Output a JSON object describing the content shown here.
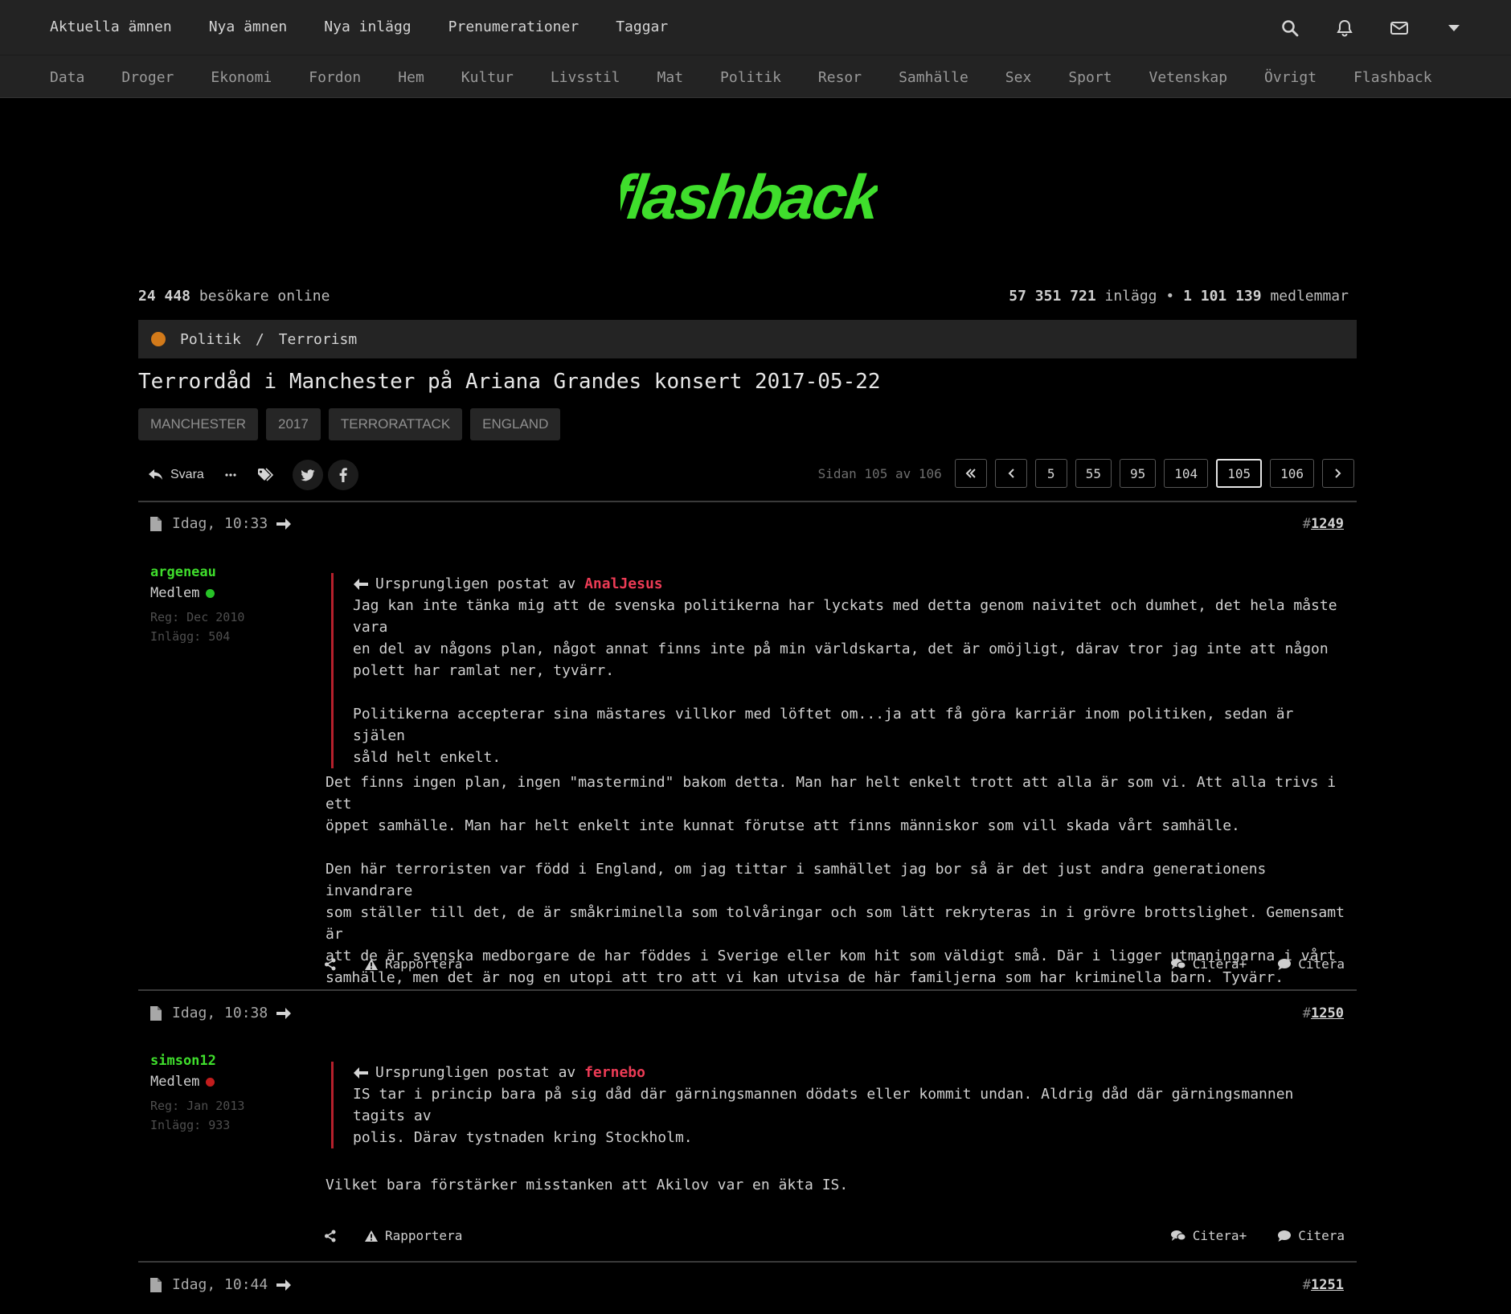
{
  "topnav": [
    "Aktuella ämnen",
    "Nya ämnen",
    "Nya inlägg",
    "Prenumerationer",
    "Taggar"
  ],
  "topicons": [
    "search-icon",
    "bell-icon",
    "mail-icon",
    "caret-down-icon"
  ],
  "categories": [
    "Data",
    "Droger",
    "Ekonomi",
    "Fordon",
    "Hem",
    "Kultur",
    "Livsstil",
    "Mat",
    "Politik",
    "Resor",
    "Samhälle",
    "Sex",
    "Sport",
    "Vetenskap",
    "Övrigt",
    "Flashback"
  ],
  "logo_text": "flashback",
  "stats": {
    "visitors_num": "24 448",
    "visitors_label": "besökare online",
    "posts_num": "57 351 721",
    "posts_label": "inlägg",
    "bullet": "•",
    "members_num": "1 101 139",
    "members_label": "medlemmar"
  },
  "breadcrumb": {
    "section": "Politik",
    "sep": "/",
    "forum": "Terrorism"
  },
  "thread_title": "Terrordåd i Manchester på Ariana Grandes konsert 2017-05-22",
  "tags": [
    "MANCHESTER",
    "2017",
    "TERRORATTACK",
    "ENGLAND"
  ],
  "actions": {
    "reply": "Svara"
  },
  "pager": {
    "info": "Sidan 105 av 106",
    "pages": [
      "5",
      "55",
      "95",
      "104",
      "105",
      "106"
    ],
    "current": "105"
  },
  "colors": {
    "accent": "#3fde2c",
    "quote_border": "#b5202c",
    "quote_author": "#ec3b55",
    "online": "#27c227",
    "offline": "#c21d1d"
  },
  "posts": [
    {
      "time": "Idag, 10:33",
      "hash": "#",
      "num": "1249",
      "user": "argeneau",
      "role": "Medlem",
      "status": "online",
      "reg": "Reg: Dec 2010",
      "posts": "Inlägg: 504",
      "quote_prefix": "Ursprungligen postat av",
      "quote_author": "AnalJesus",
      "quote_lines": [
        "Jag kan inte tänka mig att de svenska politikerna har lyckats med detta genom naivitet och dumhet, det hela måste vara",
        "en del av någons plan, något annat finns inte på min världskarta, det är omöjligt, därav tror jag inte att någon",
        "polett har ramlat ner, tyvärr.",
        "",
        "Politikerna accepterar sina mästares villkor med löftet om...ja att få göra karriär inom politiken, sedan är själen",
        "såld helt enkelt."
      ],
      "body_lines": [
        "Det finns ingen plan, ingen \"mastermind\" bakom detta. Man har helt enkelt trott att alla är som vi. Att alla trivs i ett",
        "öppet samhälle. Man har helt enkelt inte kunnat förutse att finns människor som vill skada vårt samhälle.",
        "",
        "Den här terroristen var född i England, om jag tittar i samhället jag bor så är det just andra generationens invandrare",
        "som ställer till det, de är småkriminella som tolvåringar och som lätt rekryteras in i grövre brottslighet. Gemensamt är",
        "att de är svenska medborgare de har föddes i Sverige eller kom hit som väldigt små. Där i ligger utmaningarna i vårt",
        "samhälle, men det är nog en utopi att tro att vi kan utvisa de här familjerna som har kriminella barn. Tyvärr."
      ],
      "report": "Rapportera",
      "quote_plus": "Citera+",
      "quote_btn": "Citera"
    },
    {
      "time": "Idag, 10:38",
      "hash": "#",
      "num": "1250",
      "user": "simson12",
      "role": "Medlem",
      "status": "offline",
      "reg": "Reg: Jan 2013",
      "posts": "Inlägg: 933",
      "quote_prefix": "Ursprungligen postat av",
      "quote_author": "fernebo",
      "quote_lines": [
        "IS tar i princip bara på sig dåd där gärningsmannen dödats eller kommit undan. Aldrig dåd där gärningsmannen tagits av",
        "polis. Därav tystnaden kring Stockholm."
      ],
      "body_lines": [
        "Vilket bara förstärker misstanken att Akilov var en äkta IS."
      ],
      "report": "Rapportera",
      "quote_plus": "Citera+",
      "quote_btn": "Citera"
    },
    {
      "time": "Idag, 10:44",
      "hash": "#",
      "num": "1251"
    }
  ]
}
